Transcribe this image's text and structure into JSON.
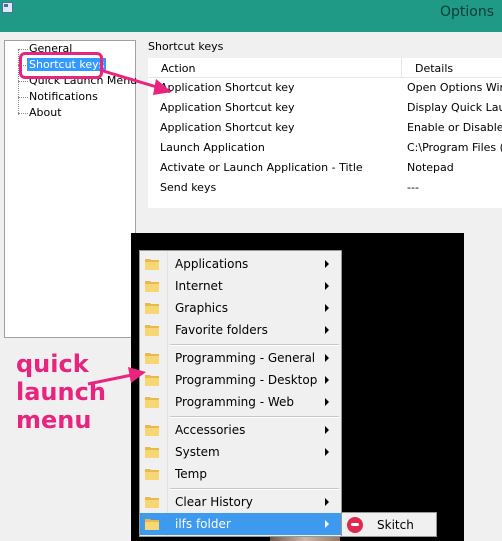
{
  "window": {
    "title": "Options"
  },
  "tree": {
    "items": [
      "General",
      "Shortcut keys",
      "Quick Launch Menu",
      "Notifications",
      "About"
    ],
    "selected_index": 1
  },
  "shortcut_keys": {
    "section_label": "Shortcut keys",
    "columns": [
      "Action",
      "Details"
    ],
    "rows": [
      [
        "Application Shortcut key",
        "Open Options Wind"
      ],
      [
        "Application Shortcut key",
        "Display Quick Laur"
      ],
      [
        "Application Shortcut key",
        "Enable or Disable S"
      ],
      [
        "Launch Application",
        "C:\\Program Files (x"
      ],
      [
        "Activate or Launch Application - Title",
        "Notepad"
      ],
      [
        "Send keys",
        "---"
      ]
    ]
  },
  "quick_launch_menu": {
    "items": [
      "Applications",
      "Internet",
      "Graphics",
      "Favorite folders",
      "Programming - General",
      "Programming - Desktop",
      "Programming - Web",
      "Accessories",
      "System",
      "Temp",
      "Clear History",
      "ilfs folder"
    ],
    "active_index": 11,
    "submenu_item": "Skitch"
  },
  "annotation": {
    "line1": "quick",
    "line2": "launch",
    "line3": "menu"
  },
  "colors": {
    "accent": "#e8247e",
    "title_bar": "#1e9a86",
    "selection": "#3399ff",
    "menu_highlight": "#3d9aef"
  }
}
